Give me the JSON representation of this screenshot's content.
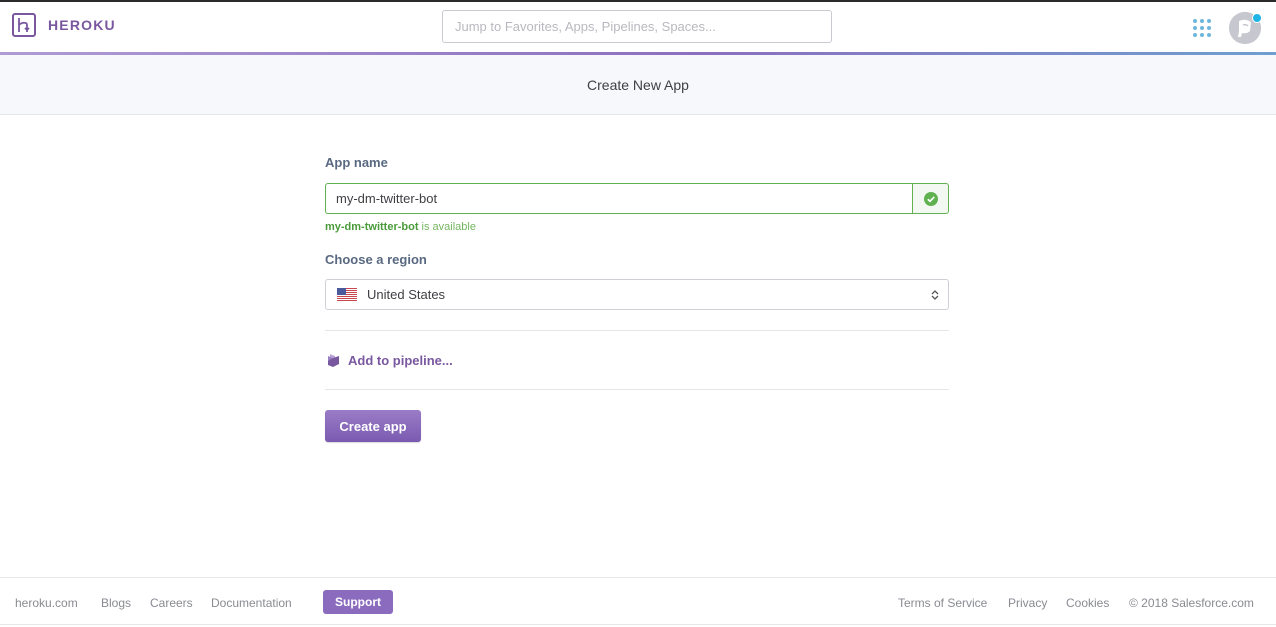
{
  "header": {
    "brand": "HEROKU",
    "search_placeholder": "Jump to Favorites, Apps, Pipelines, Spaces...",
    "colors": {
      "brand": "#79589f",
      "accent_blue": "#1fb3e6"
    }
  },
  "subheader": {
    "title": "Create New App"
  },
  "form": {
    "app_name_label": "App name",
    "app_name_value": "my-dm-twitter-bot",
    "availability_name": "my-dm-twitter-bot",
    "availability_suffix": " is available",
    "region_label": "Choose a region",
    "region_value": "United States",
    "pipeline_label": "Add to pipeline...",
    "create_button": "Create app"
  },
  "footer": {
    "links": [
      "heroku.com",
      "Blogs",
      "Careers",
      "Documentation"
    ],
    "support": "Support",
    "right_links": [
      "Terms of Service",
      "Privacy",
      "Cookies"
    ],
    "copyright": "© 2018 Salesforce.com"
  }
}
